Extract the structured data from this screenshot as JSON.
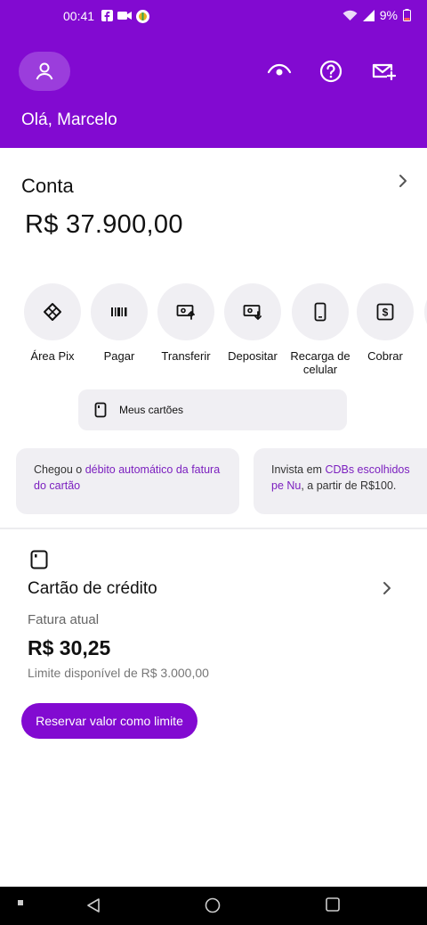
{
  "status": {
    "time": "00:41",
    "battery": "9%"
  },
  "header": {
    "greeting": "Olá, Marcelo",
    "icons": [
      "avatar-icon",
      "eye-icon",
      "help-icon",
      "invite-mail-icon"
    ],
    "color": "#820ad1"
  },
  "account": {
    "title": "Conta",
    "balance": "R$ 37.900,00"
  },
  "actions": [
    {
      "label": "Área Pix",
      "icon": "pix-icon"
    },
    {
      "label": "Pagar",
      "icon": "barcode-icon"
    },
    {
      "label": "Transferir",
      "icon": "transfer-icon"
    },
    {
      "label": "Depositar",
      "icon": "deposit-icon"
    },
    {
      "label": "Recarga de celular",
      "icon": "phone-icon"
    },
    {
      "label": "Cobrar",
      "icon": "charge-icon"
    }
  ],
  "cards_button": {
    "label": "Meus cartões"
  },
  "promos": [
    {
      "pre": "Chegou o ",
      "highlight": "débito automático da fatura do cartão",
      "post": ""
    },
    {
      "pre": "Invista em ",
      "highlight": "CDBs escolhidos pe Nu",
      "post": ", a partir de R$100."
    }
  ],
  "credit_card": {
    "title": "Cartão de crédito",
    "invoice_label": "Fatura atual",
    "invoice_value": "R$ 30,25",
    "limit_text": "Limite disponível de R$ 3.000,00",
    "reserve_button": "Reservar valor como limite"
  }
}
